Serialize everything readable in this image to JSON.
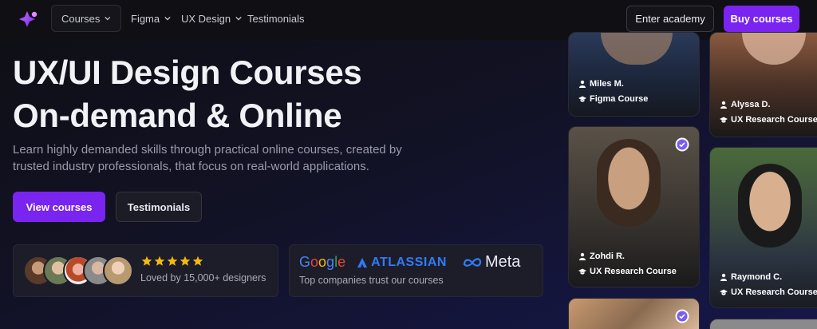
{
  "nav": {
    "courses": "Courses",
    "figma": "Figma",
    "ux_design": "UX Design",
    "testimonials": "Testimonials",
    "enter_academy": "Enter academy",
    "buy_courses": "Buy courses"
  },
  "hero": {
    "title_line1": "UX/UI Design Courses",
    "title_line2": "On-demand & Online",
    "subtitle": "Learn highly demanded skills through practical online courses, created by trusted industry professionals, that focus on real-world applications.",
    "view_courses": "View courses",
    "testimonials": "Testimonials"
  },
  "social_proof": {
    "rating_stars": 5,
    "loved_text": "Loved by 15,000+ designers"
  },
  "companies": {
    "google": "Google",
    "atlassian": "ATLASSIAN",
    "meta": "Meta",
    "trust_text": "Top companies trust our courses"
  },
  "people": [
    {
      "name": "Miles M.",
      "course": "Figma Course"
    },
    {
      "name": "Alyssa D.",
      "course": "UX Research Course"
    },
    {
      "name": "Zohdi R.",
      "course": "UX Research Course"
    },
    {
      "name": "Raymond C.",
      "course": "UX Research Course"
    }
  ],
  "colors": {
    "accent": "#7a24f0",
    "star": "#f5b90b",
    "verified": "#7a5cf0"
  }
}
